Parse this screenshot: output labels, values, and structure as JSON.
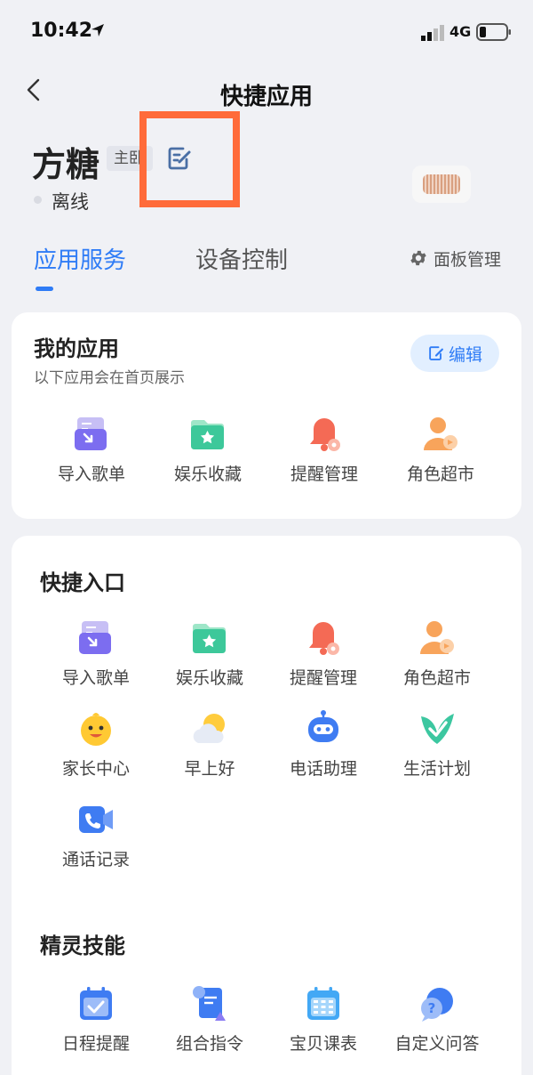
{
  "status": {
    "time": "10:42",
    "network": "4G"
  },
  "header": {
    "title": "快捷应用"
  },
  "device": {
    "name": "方糖",
    "badge": "主卧",
    "status": "离线"
  },
  "tabs": [
    {
      "label": "应用服务"
    },
    {
      "label": "设备控制"
    }
  ],
  "panel_mgmt": "面板管理",
  "my_apps": {
    "title": "我的应用",
    "subtitle": "以下应用会在首页展示",
    "edit_label": "编辑",
    "items": [
      {
        "label": "导入歌单",
        "icon": "import-playlist-icon"
      },
      {
        "label": "娱乐收藏",
        "icon": "entertainment-favorites-icon"
      },
      {
        "label": "提醒管理",
        "icon": "reminder-bell-icon"
      },
      {
        "label": "角色超市",
        "icon": "role-market-icon"
      }
    ]
  },
  "shortcuts": {
    "title": "快捷入口",
    "items": [
      {
        "label": "导入歌单",
        "icon": "import-playlist-icon"
      },
      {
        "label": "娱乐收藏",
        "icon": "entertainment-favorites-icon"
      },
      {
        "label": "提醒管理",
        "icon": "reminder-bell-icon"
      },
      {
        "label": "角色超市",
        "icon": "role-market-icon"
      },
      {
        "label": "家长中心",
        "icon": "parent-center-icon"
      },
      {
        "label": "早上好",
        "icon": "good-morning-icon"
      },
      {
        "label": "电话助理",
        "icon": "phone-assistant-icon"
      },
      {
        "label": "生活计划",
        "icon": "life-plan-icon"
      },
      {
        "label": "通话记录",
        "icon": "call-log-icon"
      }
    ]
  },
  "skills": {
    "title": "精灵技能",
    "items": [
      {
        "label": "日程提醒",
        "icon": "calendar-reminder-icon"
      },
      {
        "label": "组合指令",
        "icon": "combo-command-icon"
      },
      {
        "label": "宝贝课表",
        "icon": "kids-schedule-icon"
      },
      {
        "label": "自定义问答",
        "icon": "custom-qa-icon"
      }
    ]
  },
  "colors": {
    "accent": "#2f7cf6",
    "highlight": "#ff6b3a",
    "background": "#f0f1f5"
  }
}
